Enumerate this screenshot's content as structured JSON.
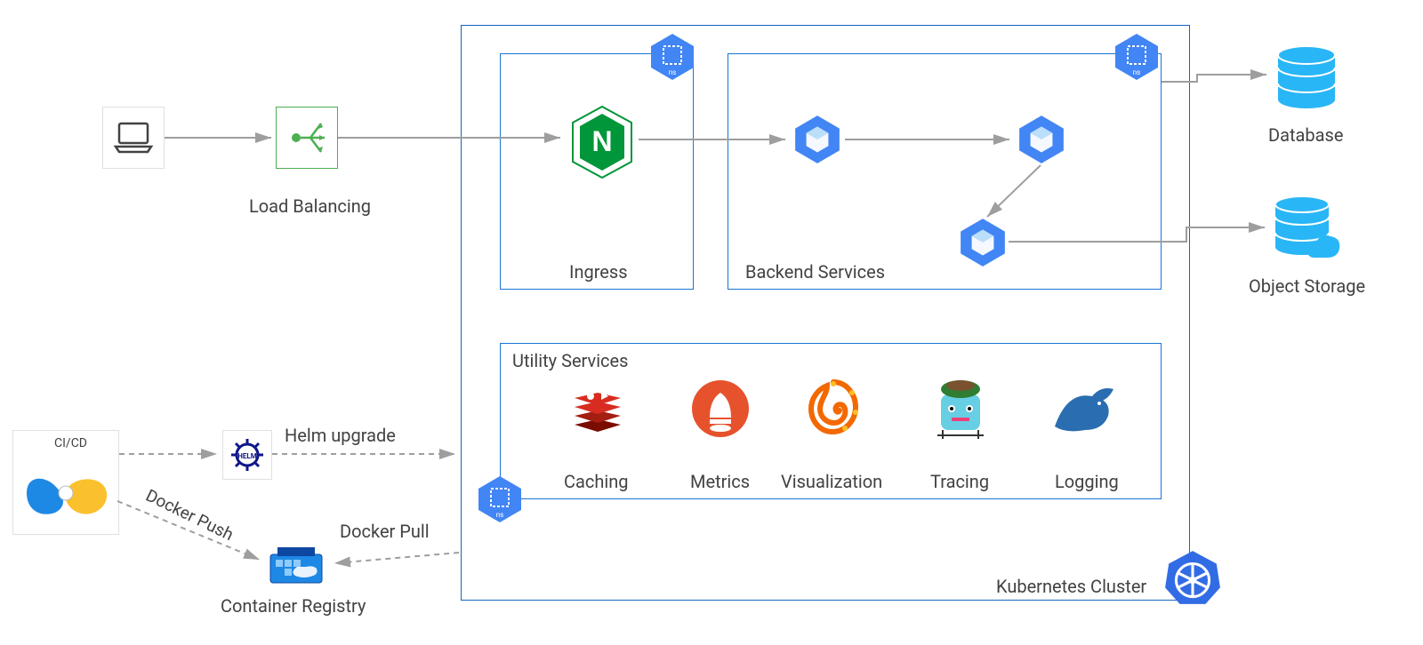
{
  "labels": {
    "load_balancing": "Load Balancing",
    "ingress": "Ingress",
    "backend_services": "Backend Services",
    "utility_services": "Utility Services",
    "kubernetes_cluster": "Kubernetes Cluster",
    "database": "Database",
    "object_storage": "Object Storage",
    "cicd": "CI/CD",
    "helm_upgrade": "Helm upgrade",
    "docker_push": "Docker Push",
    "docker_pull": "Docker Pull",
    "container_registry": "Container Registry"
  },
  "utility_items": [
    {
      "name": "Caching"
    },
    {
      "name": "Metrics"
    },
    {
      "name": "Visualization"
    },
    {
      "name": "Tracing"
    },
    {
      "name": "Logging"
    }
  ],
  "namespace_badge": "ns",
  "colors": {
    "blue": "#1e88e5",
    "dark_blue": "#1565c0",
    "green": "#009639",
    "border": "#1976d2",
    "grey": "#9e9e9e"
  }
}
